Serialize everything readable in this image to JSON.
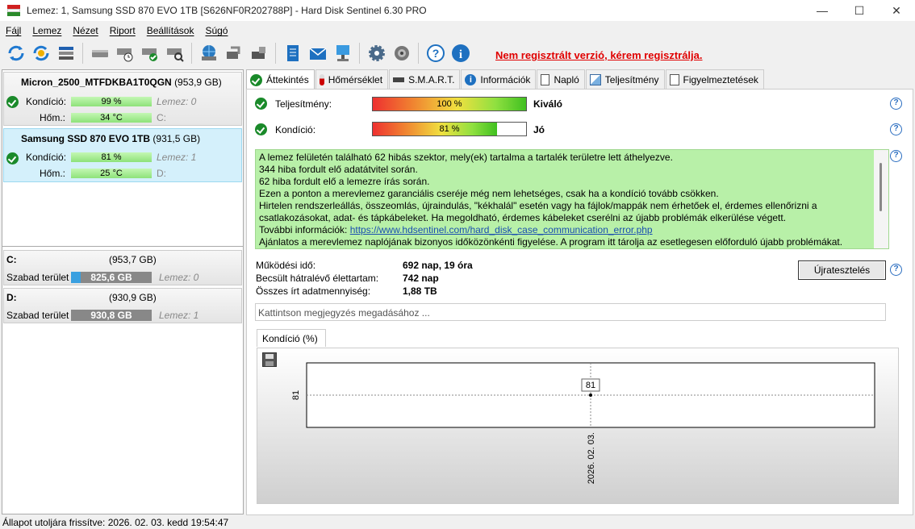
{
  "window": {
    "title": "Lemez: 1, Samsung SSD 870 EVO 1TB [S626NF0R202788P]  -  Hard Disk Sentinel 6.30 PRO",
    "minimize": "—",
    "maximize": "☐",
    "close": "✕"
  },
  "menu": [
    "Fájl",
    "Lemez",
    "Nézet",
    "Riport",
    "Beállítások",
    "Súgó"
  ],
  "toolbar": {
    "icons": [
      "refresh-icon",
      "refresh-all-icon",
      "disk-list-icon",
      "disk-icon",
      "disk-schedule-icon",
      "disk-ok-icon",
      "disk-search-icon",
      "network-disk-icon",
      "disk-transfer-icon",
      "disk-external-icon",
      "notes-icon",
      "mail-icon",
      "network-icon",
      "settings-icon",
      "sound-icon",
      "help-icon",
      "info-icon"
    ],
    "registration_notice": "Nem regisztrált verzió, kérem regisztrálja."
  },
  "disks": [
    {
      "name": "Micron_2500_MTFDKBA1T0QGN",
      "size": "(953,9 GB)",
      "condition_label": "Kondíció:",
      "condition": "99 %",
      "condition_value": 0.99,
      "temp_label": "Hőm.:",
      "temp": "34 °C",
      "errors": "Lemez: 0",
      "drive": "C:"
    },
    {
      "name": "Samsung SSD 870 EVO 1TB",
      "size": "(931,5 GB)",
      "condition_label": "Kondíció:",
      "condition": "81 %",
      "condition_value": 0.81,
      "temp_label": "Hőm.:",
      "temp": "25 °C",
      "errors": "Lemez: 1",
      "drive": "D:"
    }
  ],
  "partitions": [
    {
      "letter": "C:",
      "size": "(953,7 GB)",
      "free_label": "Szabad terület",
      "free": "825,6 GB",
      "errors": "Lemez: 0"
    },
    {
      "letter": "D:",
      "size": "(930,9 GB)",
      "free_label": "Szabad terület",
      "free": "930,8 GB",
      "errors": "Lemez: 1"
    }
  ],
  "tabs": [
    "Áttekintés",
    "Hőmérséklet",
    "S.M.A.R.T.",
    "Információk",
    "Napló",
    "Teljesítmény",
    "Figyelmeztetések"
  ],
  "overview": {
    "performance_label": "Teljesítmény:",
    "performance": "100 %",
    "performance_value": 1.0,
    "performance_rating": "Kiváló",
    "condition_label": "Kondíció:",
    "condition": "81 %",
    "condition_value": 0.81,
    "condition_rating": "Jó",
    "message": [
      "A lemez felületén található 62 hibás szektor, mely(ek) tartalma a tartalék területre lett áthelyezve.",
      "344 hiba fordult elő adatátvitel során.",
      "62 hiba fordult elő a lemezre írás során.",
      "Ezen a ponton a merevlemez garanciális cseréje még nem lehetséges, csak ha a kondíció tovább csökken.",
      "Hirtelen rendszerleállás, összeomlás, újraindulás, \"kékhalál\" esetén vagy ha fájlok/mappák nem érhetőek el, érdemes ellenőrizni a csatlakozásokat, adat- és tápkábeleket. Ha megoldható, érdemes kábeleket cserélni az újabb problémák elkerülése végett."
    ],
    "more_info_label": "További információk: ",
    "more_info_link": "https://www.hdsentinel.com/hard_disk_case_communication_error.php",
    "message_last": "Ajánlatos a merevlemez naplójának bizonyos időközönkénti figyelése. A program itt tárolja az esetlegesen előforduló újabb problémákat.",
    "uptime_label": "Működési idő:",
    "uptime": "692 nap, 19 óra",
    "remaining_label": "Becsült hátralévő élettartam:",
    "remaining": "742 nap",
    "written_label": "Összes írt adatmennyiség:",
    "written": "1,88 TB",
    "retest_button": "Újratesztelés",
    "note_placeholder": "Kattintson megjegyzés megadásához ..."
  },
  "chart_tab": "Kondíció  (%)",
  "chart_data": {
    "type": "line",
    "x": [
      "2026. 02. 03."
    ],
    "series": [
      {
        "values": [
          81
        ]
      }
    ],
    "y_tick_labels": [
      "81"
    ],
    "data_labels": [
      "81"
    ],
    "grid": true
  },
  "status": "Állapot utoljára frissítve: 2026. 02. 03. kedd 19:54:47"
}
